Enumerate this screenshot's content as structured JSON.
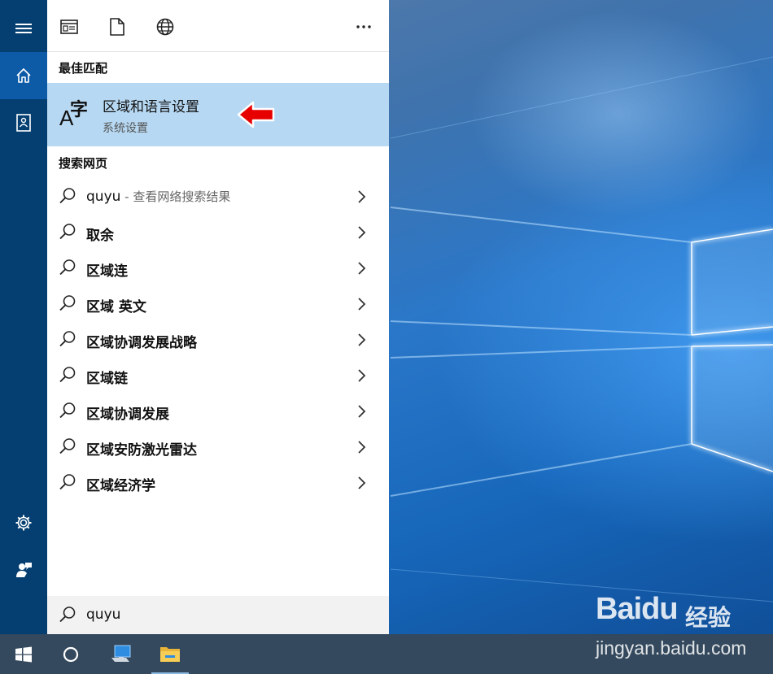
{
  "sidebar": {
    "items": [
      {
        "icon": "hamburger-menu-icon"
      },
      {
        "icon": "home-icon",
        "active": true
      },
      {
        "icon": "notebook-icon"
      },
      {
        "icon": "gear-icon"
      },
      {
        "icon": "feedback-icon"
      }
    ]
  },
  "toolbar": {
    "icons": [
      "apps-filter-icon",
      "documents-filter-icon",
      "web-filter-icon",
      "more-options-icon"
    ]
  },
  "best_match": {
    "section_label": "最佳匹配",
    "title": "区域和语言设置",
    "subtitle": "系统设置",
    "icon": "language-settings-icon"
  },
  "web": {
    "section_label": "搜索网页",
    "first": {
      "text": "quyu",
      "hint": " - 查看网络搜索结果"
    },
    "suggestions": [
      "取余",
      "区域连",
      "区域 英文",
      "区域协调发展战略",
      "区域链",
      "区域协调发展",
      "区域安防激光雷达",
      "区域经济学"
    ]
  },
  "search": {
    "value": "quyu"
  },
  "taskbar": {
    "icons": [
      "windows-start-icon",
      "cortana-icon",
      "computer-icon",
      "file-explorer-icon"
    ]
  },
  "watermark": {
    "logo_text": "Baidu",
    "cn_text": "经验",
    "url": "jingyan.baidu.com"
  },
  "colors": {
    "sidebar_bg": "#053f72",
    "sidebar_active": "#0d5aa7",
    "selected_row": "#b6d8f2",
    "taskbar_bg": "#34495d",
    "arrow": "#e60000"
  }
}
